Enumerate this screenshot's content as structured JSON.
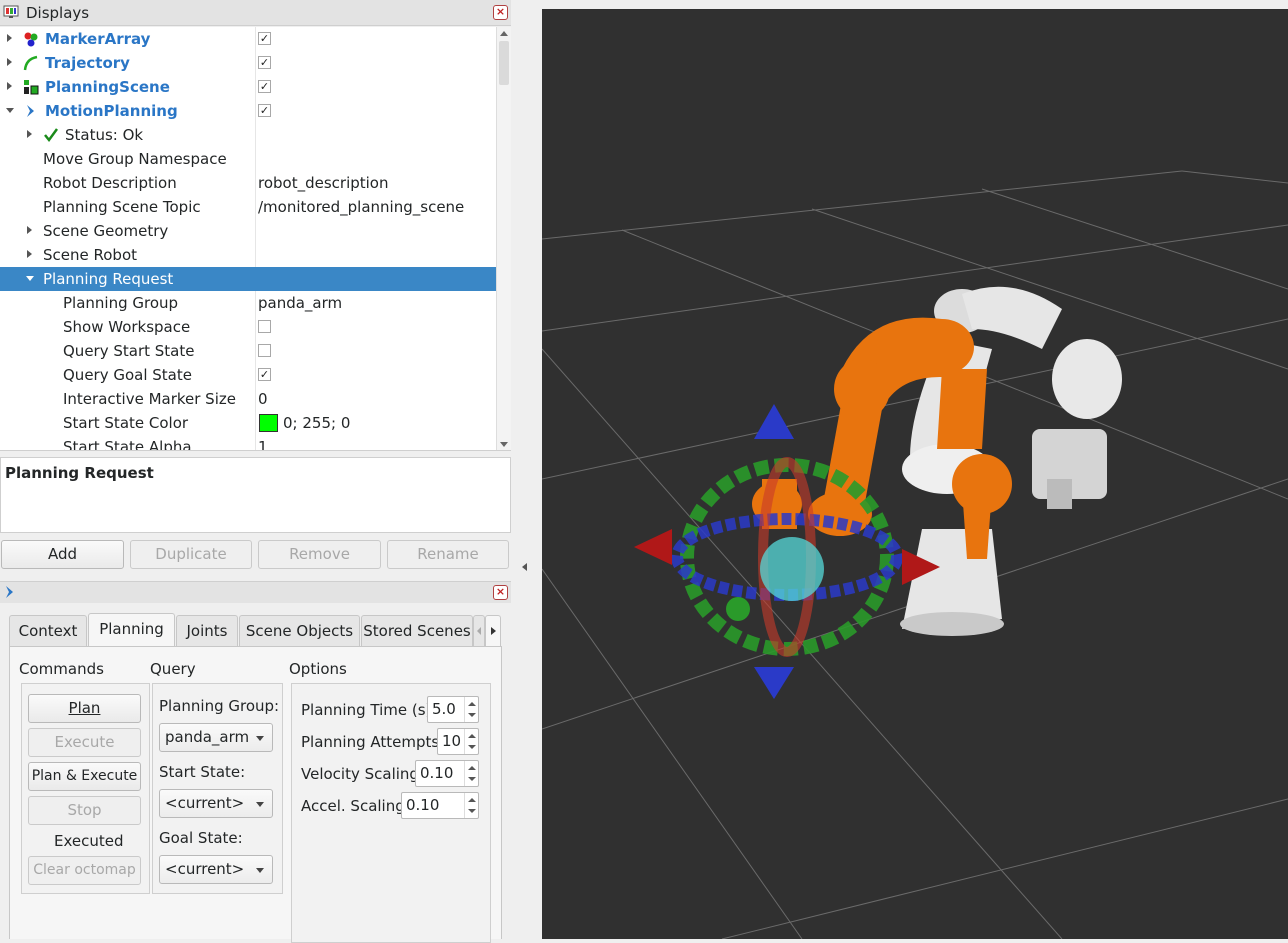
{
  "displays": {
    "title": "Displays",
    "rows": [
      {
        "name": "MarkerArray",
        "checked": "✓"
      },
      {
        "name": "Trajectory",
        "checked": "✓"
      },
      {
        "name": "PlanningScene",
        "checked": "✓"
      },
      {
        "name": "MotionPlanning",
        "checked": "✓"
      }
    ],
    "status": "Status: Ok",
    "props": {
      "move_group_ns": "Move Group Namespace",
      "robot_description_label": "Robot Description",
      "robot_description_value": "robot_description",
      "planning_scene_topic_label": "Planning Scene Topic",
      "planning_scene_topic_value": "/monitored_planning_scene",
      "scene_geometry": "Scene Geometry",
      "scene_robot": "Scene Robot",
      "planning_request": "Planning Request",
      "planning_group_label": "Planning Group",
      "planning_group_value": "panda_arm",
      "show_workspace": "Show Workspace",
      "query_start_state": "Query Start State",
      "query_goal_state": "Query Goal State",
      "interactive_marker_size_label": "Interactive Marker Size",
      "interactive_marker_size_value": "0",
      "start_state_color_label": "Start State Color",
      "start_state_color_value": "0; 255; 0",
      "start_state_alpha_label": "Start State Alpha",
      "start_state_alpha_value": "1"
    },
    "checks": {
      "show_workspace": "",
      "query_start_state": "",
      "query_goal_state": "✓"
    },
    "description": "Planning Request",
    "buttons": {
      "add": "Add",
      "duplicate": "Duplicate",
      "remove": "Remove",
      "rename": "Rename"
    }
  },
  "motion_planning": {
    "tabs": [
      "Context",
      "Planning",
      "Joints",
      "Scene Objects",
      "Stored Scenes"
    ],
    "active_tab": "Planning",
    "commands": {
      "title": "Commands",
      "plan": "Plan",
      "execute": "Execute",
      "plan_execute": "Plan & Execute",
      "stop": "Stop",
      "status": "Executed",
      "clear_octomap": "Clear octomap"
    },
    "query": {
      "title": "Query",
      "planning_group_label": "Planning Group:",
      "planning_group_value": "panda_arm",
      "start_state_label": "Start State:",
      "start_state_value": "<current>",
      "goal_state_label": "Goal State:",
      "goal_state_value": "<current>"
    },
    "options": {
      "title": "Options",
      "planning_time_label": "Planning Time (s):",
      "planning_time_value": "5.0",
      "planning_attempts_label": "Planning Attempts:",
      "planning_attempts_value": "10",
      "velocity_scaling_label": "Velocity Scaling:",
      "velocity_scaling_value": "0.10",
      "accel_scaling_label": "Accel. Scaling:",
      "accel_scaling_value": "0.10"
    }
  },
  "colors": {
    "selection": "#3a87c6",
    "link": "#2a76c6",
    "viewport_bg": "#303030",
    "robot_orange": "#e8740e",
    "start_state_color": "#00ff00"
  }
}
